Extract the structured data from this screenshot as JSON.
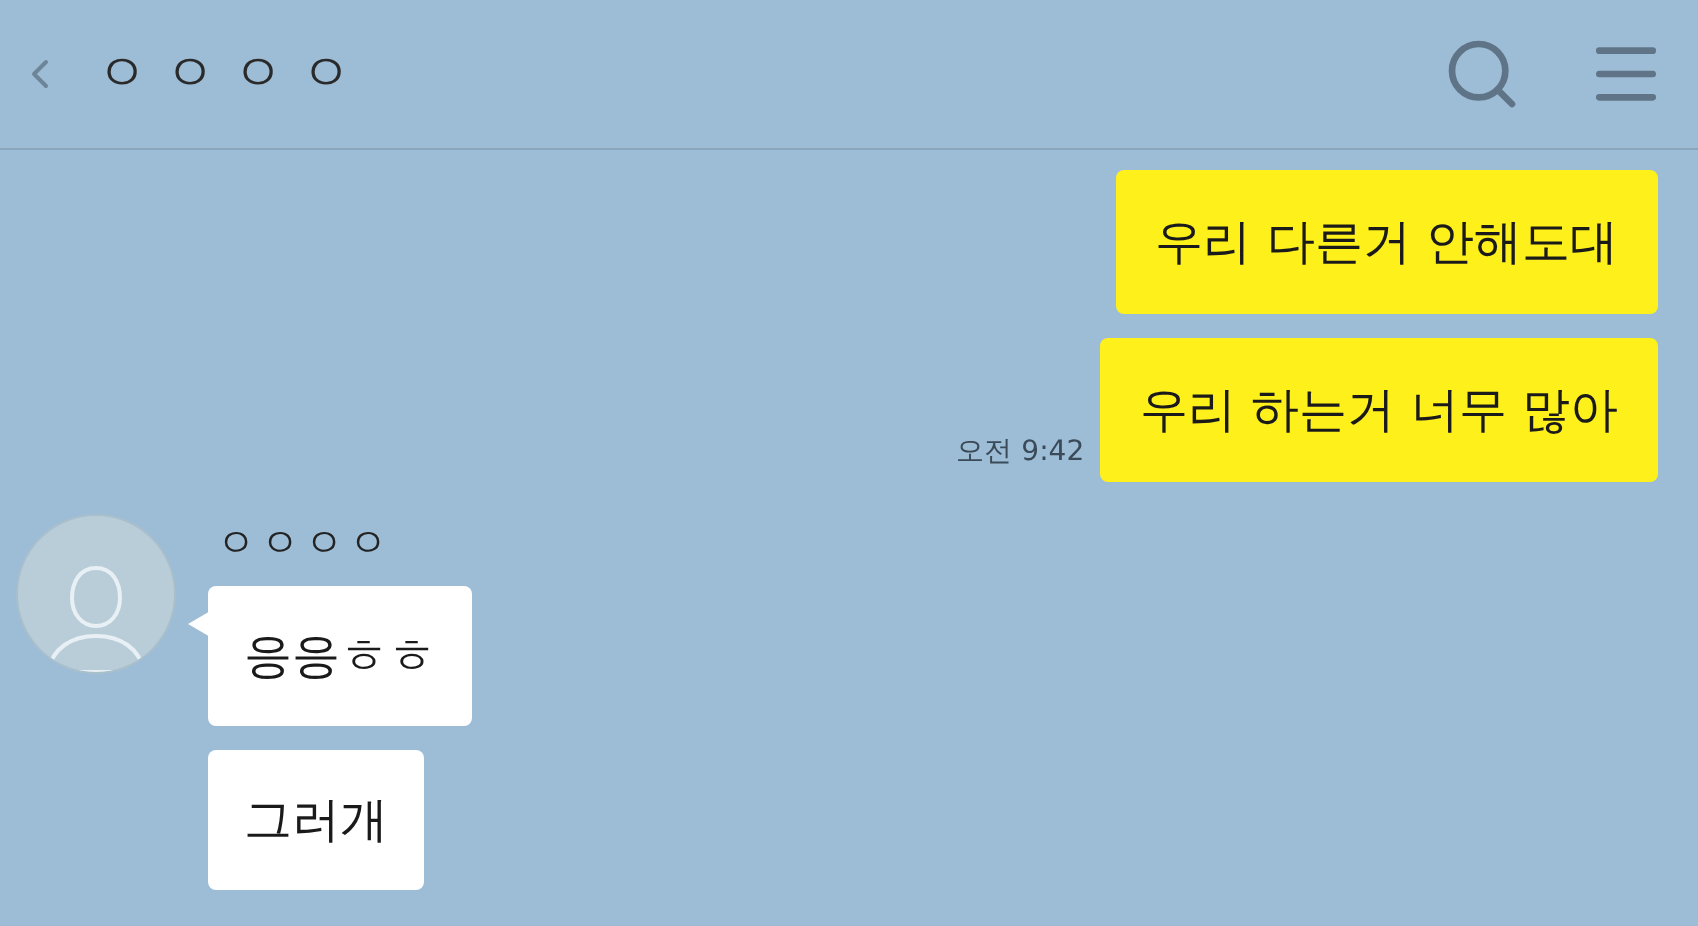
{
  "header": {
    "title": "ㅇㅇㅇㅇ"
  },
  "messages": [
    {
      "kind": "sent",
      "text": "우리 다른거 안해도대"
    },
    {
      "kind": "sent",
      "text": "우리 하는거 너무 많아",
      "time": "오전 9:42"
    },
    {
      "kind": "received",
      "sender": "ㅇㅇㅇㅇ",
      "texts": [
        "응응ㅎㅎ",
        "그러개"
      ]
    }
  ]
}
